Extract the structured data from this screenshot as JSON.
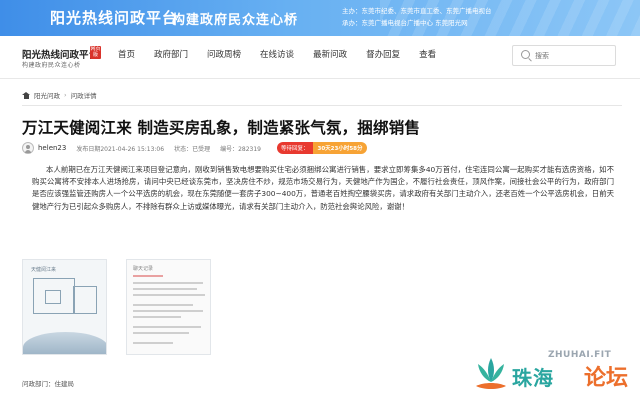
{
  "banner": {
    "title": "阳光热线问政平台",
    "slogan": "构建政府民众连心桥",
    "sponsors": "主办：东莞市纪委、东莞市直工委、东莞广播电视台",
    "organizer": "承办：东莞广播电视台广播中心 东莞阳光网"
  },
  "nav": {
    "logo_title": "阳光热线问政平台",
    "logo_badge": "网页版",
    "logo_sub": "构建政府民众连心桥",
    "items": [
      "首页",
      "政府部门",
      "问政周榜",
      "在线访谈",
      "最新问政",
      "督办回复",
      "查看"
    ],
    "search_placeholder": "搜索"
  },
  "breadcrumb": {
    "home": "阳光问政",
    "current": "问政详情"
  },
  "article": {
    "title": "万江天健阅江来 制造买房乱象，制造紧张气氛，捆绑销售",
    "author": "helen23",
    "published": "发布日期2021-04-26 15:13:06",
    "status": "状态：已受理",
    "id": "编号：282319",
    "badge_a": "等待回复：",
    "badge_b": "30天23小时58分",
    "body": "本人前期已在万江天健阅江来项目登记意向，刚收到销售致电想要购买住宅必须捆绑公寓进行销售，要求立即筹集多40万首付，住宅连同公寓一起购买才能有选房资格，如不购买公寓将不安排本人进场抢房，请问中央已经谈东莞市，坚决房住不炒，规范市场交易行为，天健地产作为国企，不履行社会责任，顶风作案，间接社会公平的行为，政府部门是否应该强监管还购房人一个公平选房的机会，现在东莞随便一套房子300~400万，普通老百姓掏空腰袋买房，请求政府有关部门主动介入，还老百姓一个公平选房机会，日前天健地产行为已引起众多购房人，不排除有群众上访或媒体曝光，请求有关部门主动介入，防范社会舆论风险，谢谢！"
  },
  "attachments": [
    {
      "caption": "天健阅江来"
    },
    {
      "caption": "聊天记录"
    }
  ],
  "footer": {
    "department": "问政部门：住建局"
  },
  "watermark": {
    "domain": "ZHUHAI.FIT",
    "text1": "珠海",
    "text2": "论坛"
  }
}
